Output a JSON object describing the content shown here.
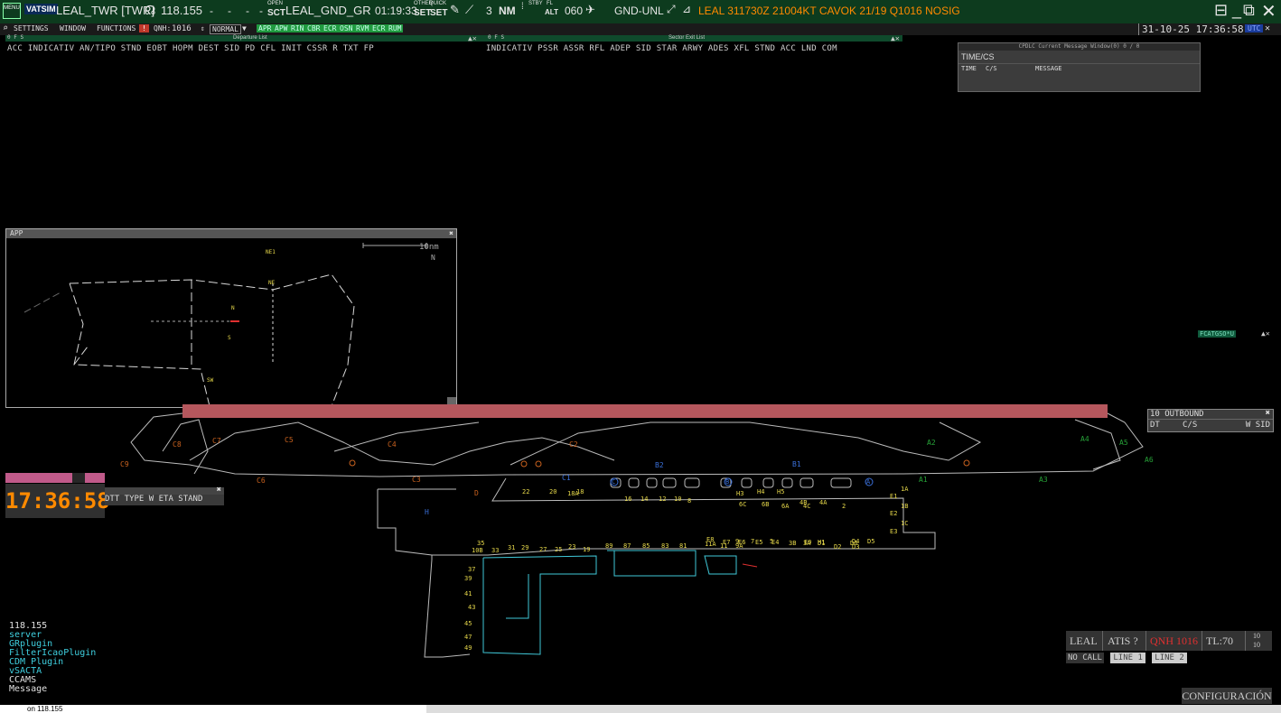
{
  "topbar": {
    "menu_label": "MENU",
    "logo_text": "VATSIM",
    "callsign": "LEAL_TWR [TWR]",
    "frequency": "118.155",
    "dash1": "-",
    "dash2": "-",
    "dash3": "-",
    "dash4": "-",
    "open_label": "OPEN",
    "sct_label": "SCT",
    "gnd_position": "LEAL_GND_GR",
    "time": "01:19:33",
    "other_label": "OTHER",
    "quick_label": "QUICK",
    "set1": "SET",
    "set2": "SET",
    "count": "3",
    "nm_label": "NM",
    "stby_label": "STBY",
    "fl_label": "FL",
    "alt_label": "ALT",
    "altitude": "060",
    "gnd_unl": "GND-UNL",
    "metar": "LEAL 311730Z 21004KT CAVOK 21/19 Q1016 NOSIG"
  },
  "toolbar": {
    "settings": "SETTINGS",
    "window": "WINDOW",
    "functions": "FUNCTIONS",
    "qnh_label": "QNH:",
    "qnh_value": "1016",
    "mode": "NORMAL",
    "buttons": [
      "APR",
      "APW",
      "RIN",
      "CBR",
      "ECR",
      "OSN",
      "RVM",
      "ECR",
      "RUM"
    ],
    "datetime": "31-10-25 17:36:58"
  },
  "departure_list": {
    "title": "Departure List",
    "flags": "0 F S",
    "columns": "ACC INDICATIV AN/TIPO STND EOBT HOPM DEST   SID    PD  CFL  INIT CSSR R      TXT      FP"
  },
  "sector_exit_list": {
    "title": "Sector Exit List",
    "flags": "0 F S",
    "columns": "INDICATIV PSSR ASSR RFL  ADEP    SID      STAR  ARWY ADES XFL STND  ACC LND COM"
  },
  "cpdlc": {
    "title": "CPDLC Current Message Window(0) 0 / 0",
    "time_cs": "TIME/CS",
    "col_time": "TIME",
    "col_cs": "C/S",
    "col_message": "MESSAGE"
  },
  "app_window": {
    "title": "APP",
    "scale_label": "10nm",
    "north": "N",
    "fixes": [
      "NE1",
      "NE",
      "N",
      "S",
      "SW"
    ]
  },
  "arrivals": {
    "columns": "DTT TYPE W ETA   STAND"
  },
  "clock": "17:36:58",
  "outbound": {
    "title": "10 OUTBOUND",
    "col_dt": "DT",
    "col_cs": "C/S",
    "col_wsid": "W SID"
  },
  "right_tag": "FCATGSO*U",
  "atis_panel": {
    "airport": "LEAL",
    "atis": "ATIS ?",
    "qnh": "QNH 1016",
    "tl": "TL:70",
    "tl_top": "10",
    "tl_bottom": "10"
  },
  "lines": {
    "no_call": "NO CALL",
    "line1": "LINE 1",
    "line2": "LINE 2"
  },
  "config_button": "CONFIGURACIÓN",
  "messages": [
    {
      "text": "118.155",
      "color": "#e0e0e0"
    },
    {
      "text": "server",
      "color": "#3fd0e0"
    },
    {
      "text": "GRplugin",
      "color": "#3fd0e0"
    },
    {
      "text": "FilterIcaoPlugin",
      "color": "#3fd0e0"
    },
    {
      "text": "CDM Plugin",
      "color": "#3fd0e0"
    },
    {
      "text": "vSACTA",
      "color": "#3fd0e0"
    },
    {
      "text": "CCAMS",
      "color": "#e0e0e0"
    },
    {
      "text": "Message",
      "color": "#e0e0e0"
    }
  ],
  "command_line": "on 118.155",
  "taxiways_orange": [
    "C8",
    "C7",
    "C5",
    "C4",
    "C9",
    "C6",
    "C3",
    "C2",
    "D"
  ],
  "taxiways_green": [
    "A2",
    "A4",
    "A5",
    "A6",
    "A1",
    "A3"
  ],
  "taxiways_blue": [
    "B2",
    "B1",
    "C1",
    "H",
    "C",
    "B",
    "A"
  ],
  "stands_yellow": [
    "22",
    "20",
    "18A",
    "18",
    "16",
    "14",
    "12",
    "10",
    "8",
    "1A",
    "E1",
    "1B",
    "E2",
    "1C",
    "E3",
    "2",
    "4A",
    "4B",
    "4C",
    "6A",
    "6B",
    "6C",
    "H3",
    "H4",
    "H5"
  ],
  "stands_yellow_south": [
    "35",
    "10B",
    "33",
    "31",
    "29",
    "27",
    "25",
    "23",
    "19",
    "89",
    "87",
    "85",
    "83",
    "81",
    "11A",
    "11",
    "9A",
    "9",
    "7",
    "5",
    "3B",
    "3A",
    "D1",
    "D2",
    "D3",
    "D4",
    "D5",
    "D6",
    "E4",
    "E5",
    "E6",
    "E7",
    "E8",
    "E9",
    "H1",
    "H2"
  ],
  "stands_west": [
    "37",
    "39",
    "41",
    "43",
    "45",
    "47",
    "49"
  ],
  "colors": {
    "topbar": "#0d3b1e",
    "runway": "#b5575d",
    "clock": "#ff8a00",
    "metar": "#ff8a00",
    "taxiway_orange": "#c8611e",
    "taxiway_green": "#27a238",
    "taxiway_blue": "#3a6fd8",
    "stand_yellow": "#e6d84a",
    "terminal_cyan": "#40c8d8"
  }
}
